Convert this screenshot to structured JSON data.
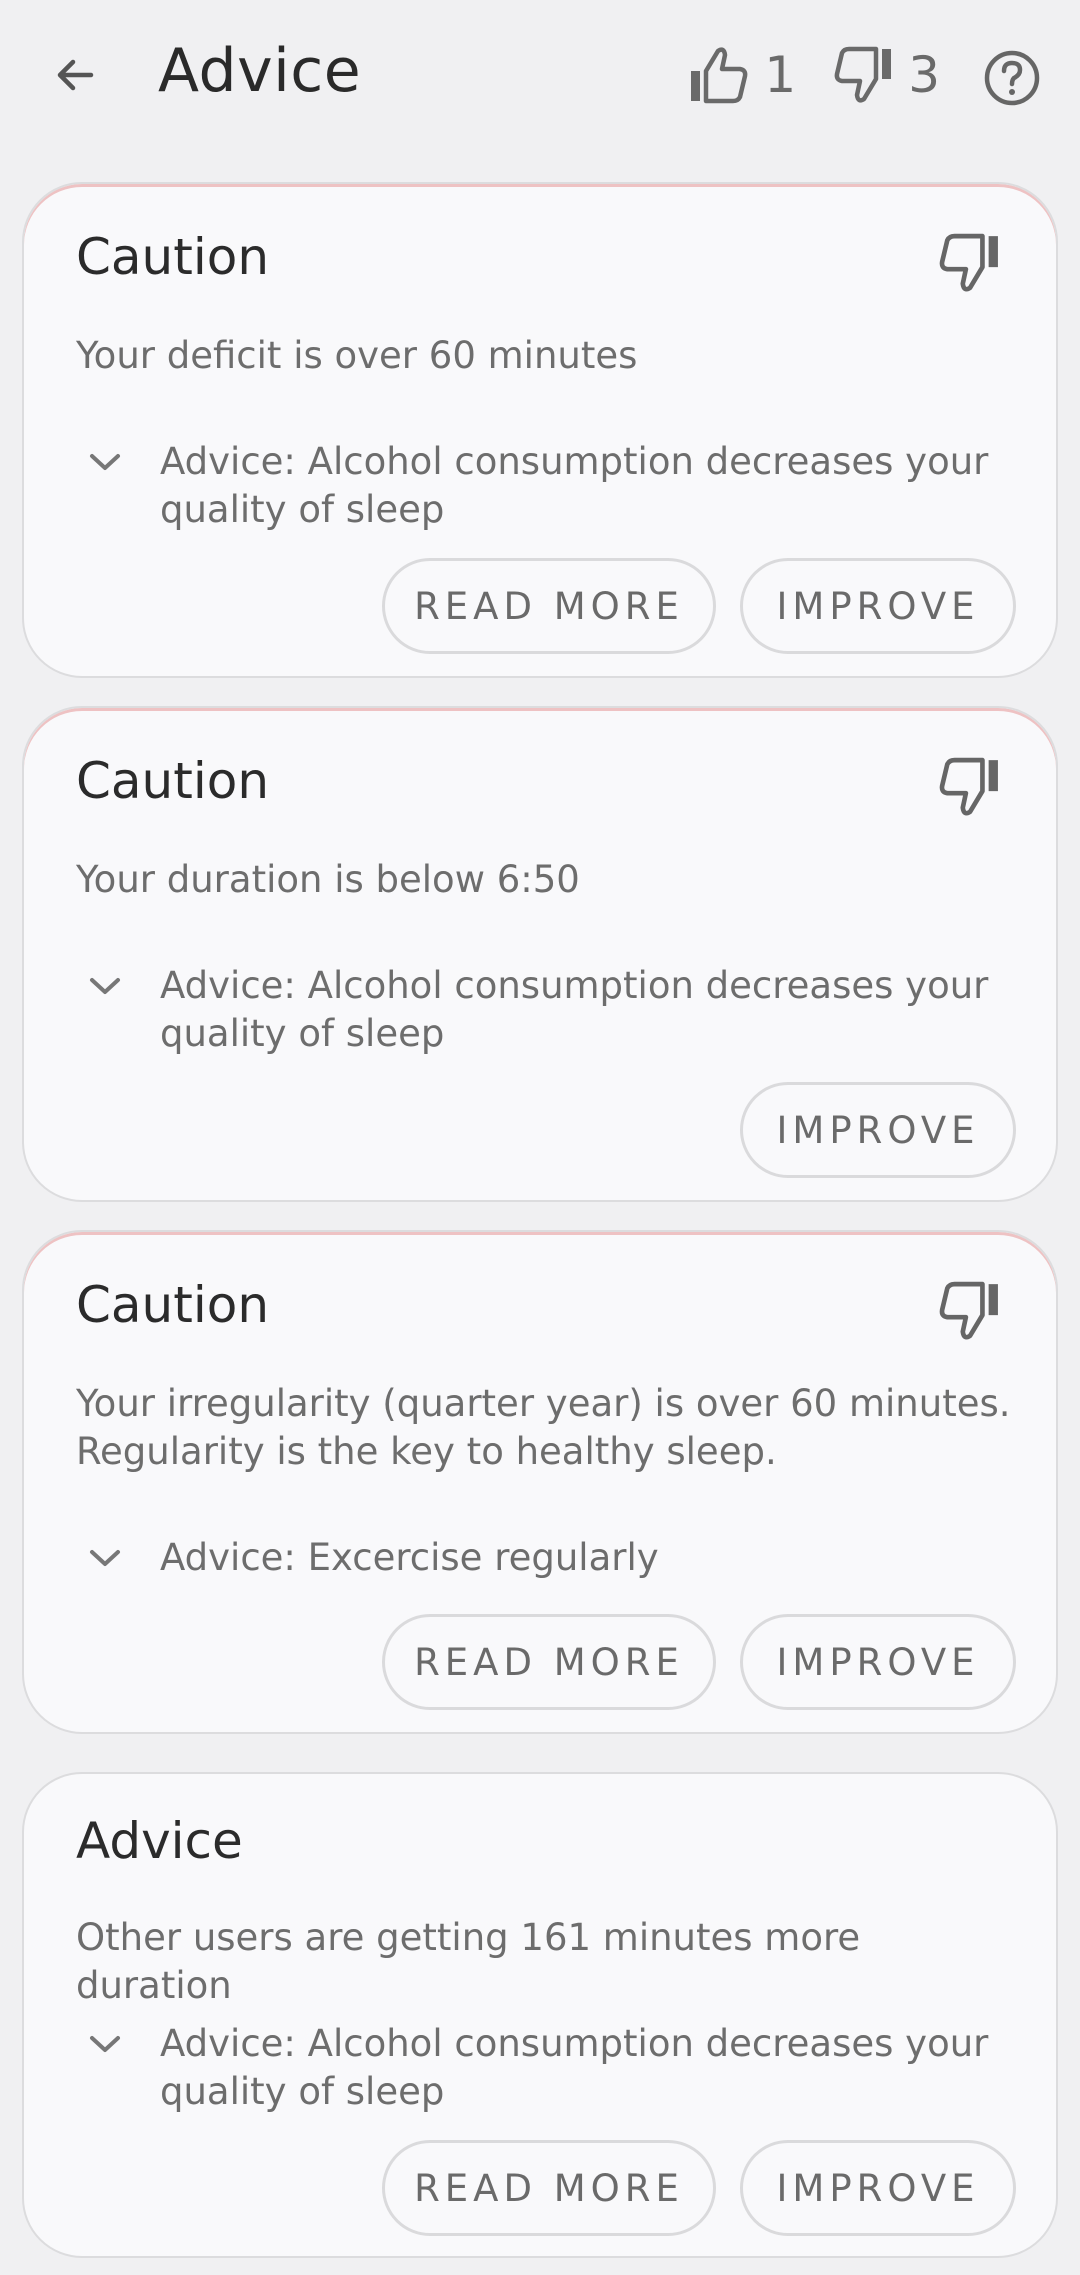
{
  "header": {
    "title": "Advice",
    "likes": "1",
    "dislikes": "3"
  },
  "cards": [
    {
      "heading": "Caution",
      "message": "Your deficit is over 60 minutes",
      "advice": "Advice: Alcohol consumption decreases your quality of sleep",
      "read_more": "READ MORE",
      "improve": "IMPROVE"
    },
    {
      "heading": "Caution",
      "message": "Your duration is below 6:50",
      "advice": "Advice: Alcohol consumption decreases your quality of sleep",
      "improve": "IMPROVE"
    },
    {
      "heading": "Caution",
      "message": "Your irregularity (quarter year) is over 60 minutes. Regularity is the key to healthy sleep.",
      "advice": "Advice: Excercise regularly",
      "read_more": "READ MORE",
      "improve": "IMPROVE"
    },
    {
      "heading": "Advice",
      "message": "Other users are getting 161 minutes more duration",
      "advice": "Advice: Alcohol consumption decreases your quality of sleep",
      "read_more": "READ MORE",
      "improve": "IMPROVE"
    }
  ],
  "icons": {
    "back": "arrow-left-icon",
    "like": "thumbs-up-icon",
    "dislike": "thumbs-down-icon",
    "help": "help-circle-icon",
    "expand": "chevron-down-icon"
  },
  "colors": {
    "background": "#f0f0f2",
    "card": "#f9f9fb",
    "caution_accent": "#e69696"
  }
}
